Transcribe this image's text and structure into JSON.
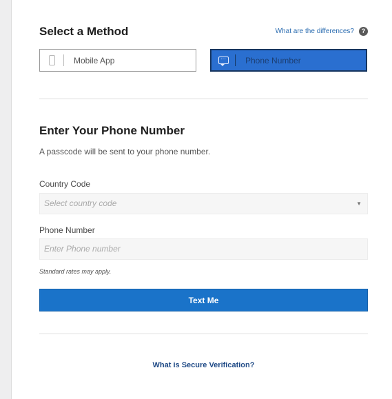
{
  "method": {
    "title": "Select a Method",
    "differences_link": "What are the differences?",
    "help_glyph": "?",
    "options": [
      {
        "label": "Mobile App",
        "icon": "mobile-phone-icon",
        "selected": false
      },
      {
        "label": "Phone Number",
        "icon": "text-message-icon",
        "selected": true
      }
    ],
    "selected_color": "#2a6fd0"
  },
  "phone_section": {
    "title": "Enter Your Phone Number",
    "subtitle": "A passcode will be sent to your phone number.",
    "country_code": {
      "label": "Country Code",
      "placeholder": "Select country code"
    },
    "phone_number": {
      "label": "Phone Number",
      "placeholder": "Enter Phone number"
    },
    "rates_note": "Standard rates may apply.",
    "submit_label": "Text Me",
    "submit_color": "#1a73c9"
  },
  "footer": {
    "link_label": "What is Secure Verification?"
  }
}
